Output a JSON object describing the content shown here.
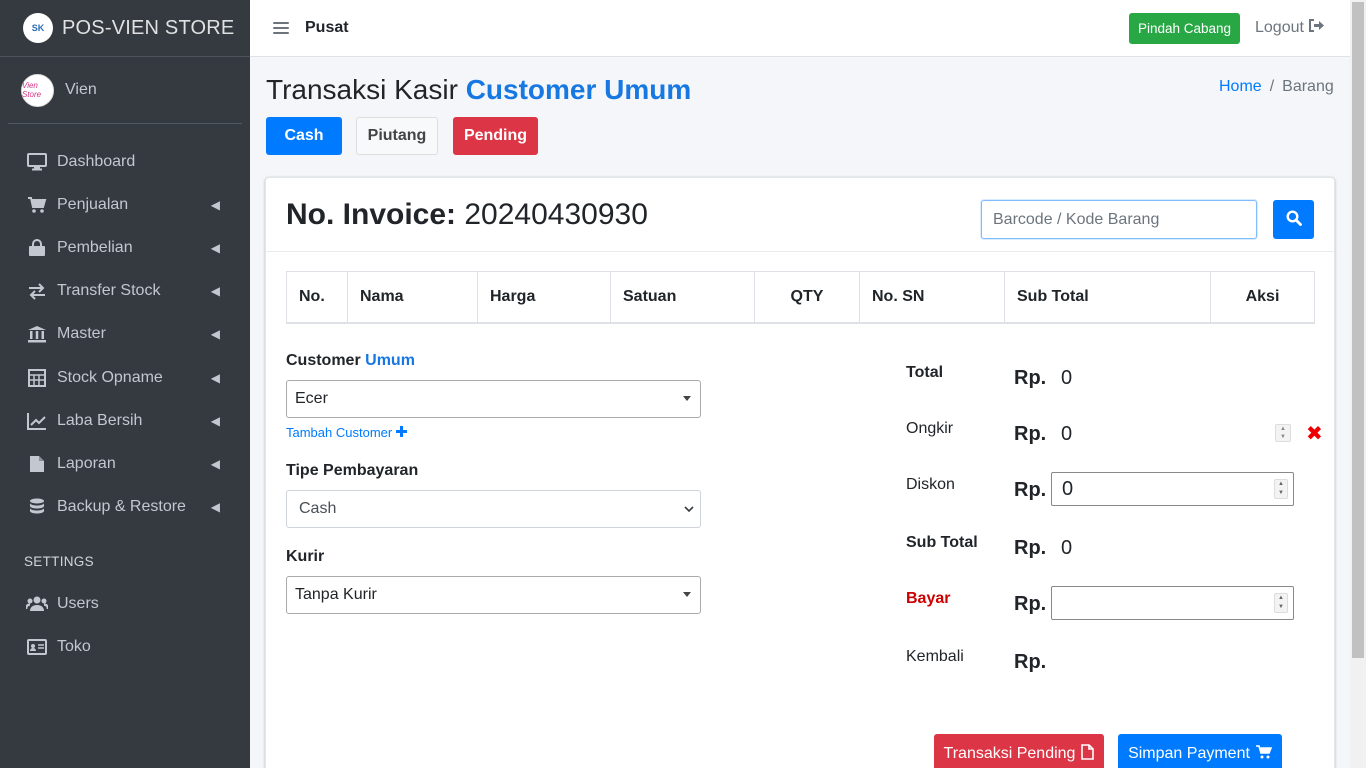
{
  "brand": {
    "logo_text": "SK",
    "name": "POS-VIEN STORE"
  },
  "user": {
    "avatar_text": "Vien Store",
    "name": "Vien"
  },
  "sidebar": {
    "items": [
      {
        "label": "Dashboard",
        "icon": "desktop-icon"
      },
      {
        "label": "Penjualan",
        "icon": "cart-icon"
      },
      {
        "label": "Pembelian",
        "icon": "shopping-bag-icon"
      },
      {
        "label": "Transfer Stock",
        "icon": "exchange-icon"
      },
      {
        "label": "Master",
        "icon": "bank-icon"
      },
      {
        "label": "Stock Opname",
        "icon": "calculator-icon"
      },
      {
        "label": "Laba Bersih",
        "icon": "chart-line-icon"
      },
      {
        "label": "Laporan",
        "icon": "file-icon"
      },
      {
        "label": "Backup & Restore",
        "icon": "database-icon"
      }
    ],
    "settings_header": "SETTINGS",
    "settings_items": [
      {
        "label": "Users",
        "icon": "users-icon"
      },
      {
        "label": "Toko",
        "icon": "id-card-icon"
      }
    ]
  },
  "topbar": {
    "branch": "Pusat",
    "pindah_label": "Pindah Cabang",
    "logout_label": "Logout"
  },
  "header": {
    "title_prefix": "Transaksi Kasir",
    "title_highlight": "Customer Umum",
    "breadcrumb": {
      "home": "Home",
      "sep": "/",
      "current": "Barang"
    }
  },
  "tabs": {
    "cash": "Cash",
    "piutang": "Piutang",
    "pending": "Pending"
  },
  "invoice": {
    "label": "No. Invoice:",
    "number": "20240430930"
  },
  "search": {
    "placeholder": "Barcode / Kode Barang"
  },
  "table": {
    "columns": [
      "No.",
      "Nama",
      "Harga",
      "Satuan",
      "QTY",
      "No. SN",
      "Sub Total",
      "Aksi"
    ]
  },
  "form": {
    "customer_label": "Customer",
    "customer_highlight": "Umum",
    "customer_value": "Ecer",
    "add_customer": "Tambah Customer",
    "payment_label": "Tipe Pembayaran",
    "payment_value": "Cash",
    "courier_label": "Kurir",
    "courier_value": "Tanpa Kurir"
  },
  "summary": {
    "currency": "Rp.",
    "total_label": "Total",
    "total_value": "0",
    "ongkir_label": "Ongkir",
    "ongkir_value": "0",
    "diskon_label": "Diskon",
    "diskon_value": "0",
    "subtotal_label": "Sub Total",
    "subtotal_value": "0",
    "bayar_label": "Bayar",
    "bayar_value": "",
    "kembali_label": "Kembali"
  },
  "actions": {
    "pending_label": "Transaksi Pending",
    "simpan_label": "Simpan Payment"
  },
  "colors": {
    "sidebar": "#343a40",
    "primary": "#007bff",
    "danger": "#dc3545",
    "success": "#28a745",
    "title_accent": "#1778e2"
  }
}
